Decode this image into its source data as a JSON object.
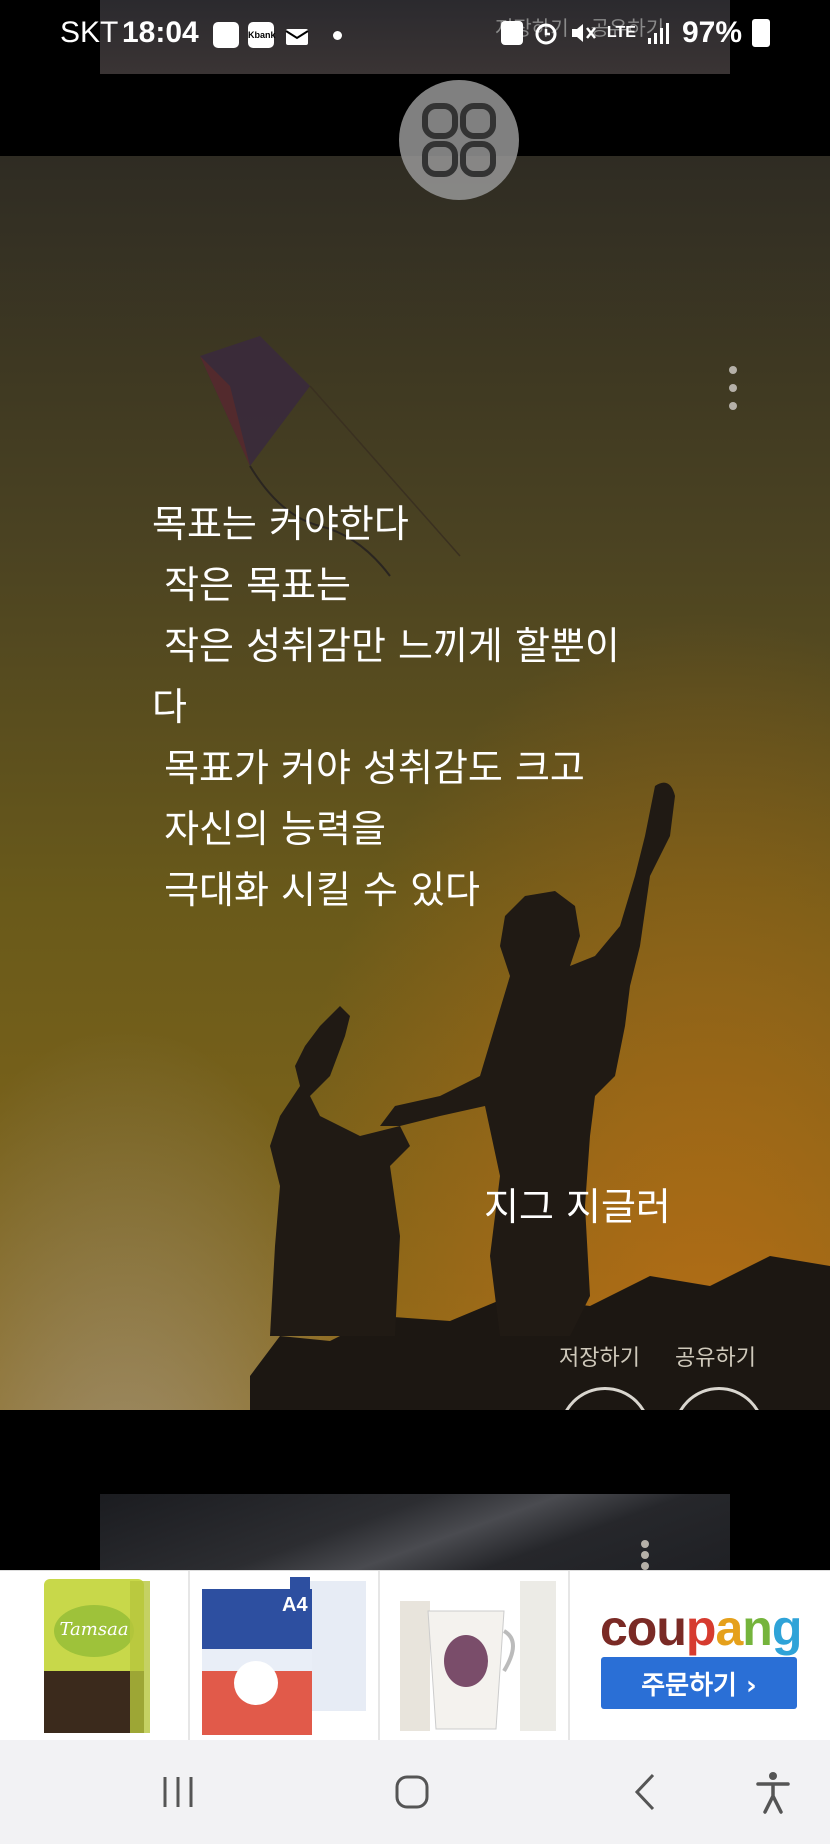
{
  "status_bar": {
    "carrier": "SKT",
    "time": "18:04",
    "notification_icons": [
      "memo-icon",
      "kbank-icon",
      "mail-icon"
    ],
    "kbank_label": "Kbank",
    "network": "LTE",
    "battery": "97%"
  },
  "previous_card": {
    "save_label": "저장하기",
    "share_label": "공유하기"
  },
  "card": {
    "quote": "목표는 커야한다\n 작은 목표는\n 작은 성취감만 느끼게 할뿐이\n다\n 목표가 커야 성취감도 크고\n 자신의 능력을\n 극대화 시킬 수 있다",
    "author": "지그 지글러",
    "save_label": "저장하기",
    "share_label": "공유하기"
  },
  "ad": {
    "brand_parts": [
      "cou",
      "p",
      "a",
      "n",
      "g"
    ],
    "order_label": "주문하기 ›",
    "products": [
      "coconut-water-product",
      "copy-paper-product",
      "paper-cup-product"
    ]
  },
  "colors": {
    "accent_blue": "#2a6fd6",
    "card_gold": "#8a6a1a"
  }
}
